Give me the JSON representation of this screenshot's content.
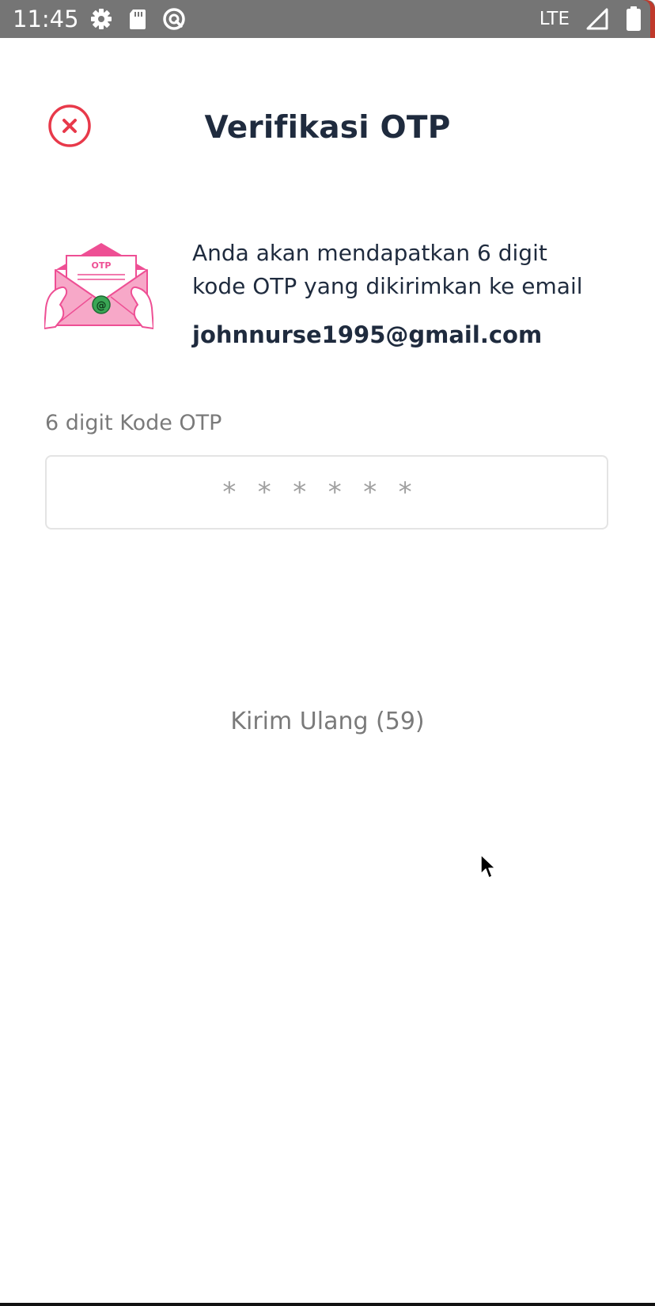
{
  "status_bar": {
    "time": "11:45",
    "network": "LTE",
    "icons": [
      "settings-icon",
      "sd-card-icon",
      "vpn-icon",
      "signal-icon",
      "battery-icon"
    ]
  },
  "header": {
    "title": "Verifikasi OTP",
    "close_icon": "close-circle-icon"
  },
  "info": {
    "illustration": "otp-envelope-illustration",
    "illustration_label": "OTP",
    "line1": "Anda akan mendapatkan 6 digit",
    "line2": "kode OTP yang dikirimkan ke email",
    "email": "johnnurse1995@gmail.com"
  },
  "otp": {
    "label": "6 digit Kode OTP",
    "value": "",
    "placeholder": "******"
  },
  "resend": {
    "label": "Kirim Ulang (59)"
  },
  "colors": {
    "title": "#1f2b3e",
    "accent_red": "#e8394a",
    "pink": "#f7a8c8",
    "green": "#3aa655",
    "muted": "#7a7a7a"
  }
}
